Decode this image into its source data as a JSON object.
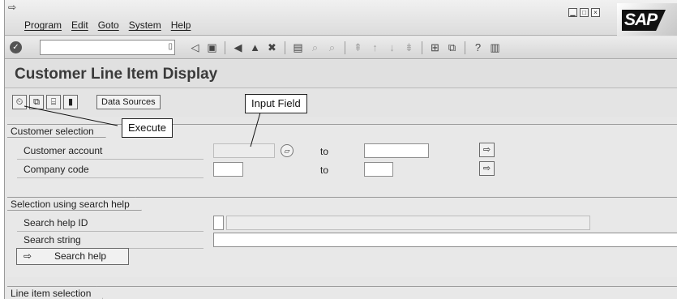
{
  "menu": {
    "items": [
      "Program",
      "Edit",
      "Goto",
      "System",
      "Help"
    ],
    "logo_text": "SAP"
  },
  "toolbar": {
    "command_field_value": "",
    "icons": [
      "save-icon",
      "back-icon",
      "exit-icon",
      "cancel-icon",
      "print-icon",
      "find-icon",
      "find-next-icon",
      "first-page-icon",
      "previous-page-icon",
      "next-page-icon",
      "last-page-icon",
      "create-session-icon",
      "shortcut-icon",
      "help-icon",
      "layout-menu-icon"
    ]
  },
  "title": "Customer Line Item Display",
  "app_toolbar": {
    "data_sources_label": "Data Sources"
  },
  "customer_selection": {
    "title": "Customer selection",
    "rows": [
      {
        "label": "Customer account",
        "from": "",
        "to_label": "to",
        "to": ""
      },
      {
        "label": "Company code",
        "from": "",
        "to_label": "to",
        "to": ""
      }
    ]
  },
  "search_help_selection": {
    "title": "Selection using search help",
    "search_help_id_label": "Search help ID",
    "search_help_id_value": "",
    "search_help_desc": "",
    "search_string_label": "Search string",
    "search_string_value": "",
    "search_help_button": "Search help"
  },
  "line_item_selection": {
    "title": "Line item selection"
  },
  "callouts": {
    "input_field": "Input Field",
    "execute": "Execute"
  },
  "colors": {
    "background": "#e6e6e6",
    "field_border": "#8e8e8e",
    "logo": "#111111"
  }
}
